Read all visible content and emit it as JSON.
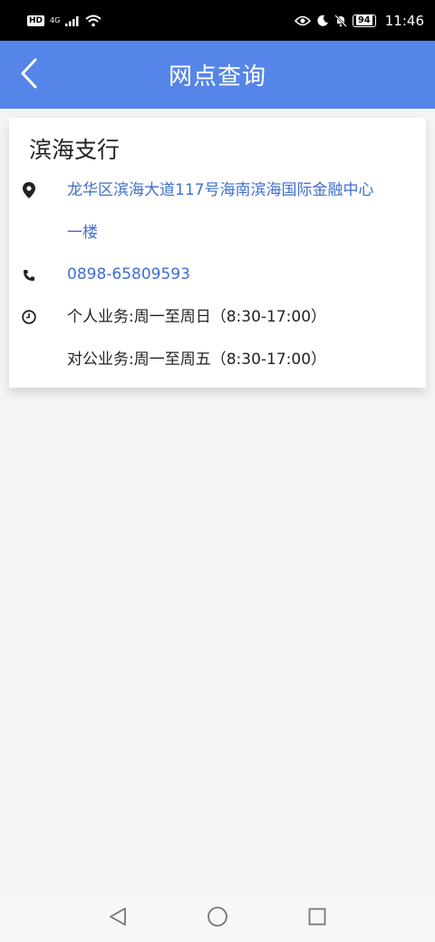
{
  "status_bar": {
    "hd": "HD",
    "network": "4G",
    "battery": "94",
    "time": "11:46",
    "icons": [
      "hd-icon",
      "signal-icon",
      "wifi-icon",
      "eye-icon",
      "moon-icon",
      "mute-icon",
      "battery-icon"
    ]
  },
  "header": {
    "title": "网点查询",
    "back_icon": "chevron-left-icon"
  },
  "branch": {
    "name": "滨海支行",
    "address_line1": "龙华区滨海大道117号海南滨海国际金融中心",
    "address_line2": "一楼",
    "phone": "0898-65809593",
    "hours_personal": "个人业务:周一至周日（8:30-17:00）",
    "hours_corporate": "对公业务:周一至周五（8:30-17:00）",
    "icons": {
      "address": "location-pin-icon",
      "phone": "phone-icon",
      "hours": "clock-icon"
    }
  },
  "nav_bar": {
    "icons": [
      "back-triangle-icon",
      "home-circle-icon",
      "recents-square-icon"
    ]
  },
  "colors": {
    "app_bar": "#5585e8",
    "link": "#3f6ecf",
    "background": "#f4f4f4"
  }
}
